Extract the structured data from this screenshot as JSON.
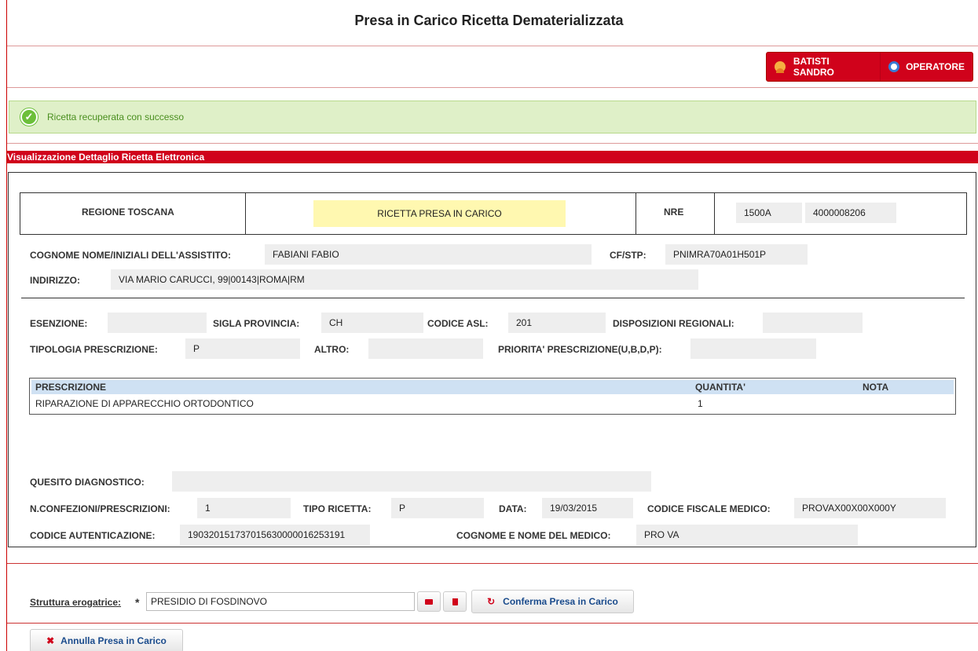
{
  "page": {
    "title": "Presa in Carico Ricetta Dematerializzata"
  },
  "user_bar": {
    "user_name": "BATISTI SANDRO",
    "role": "OPERATORE"
  },
  "message": {
    "success_text": "Ricetta recuperata con successo"
  },
  "section": {
    "title": "Visualizzazione Dettaglio Ricetta Elettronica"
  },
  "header": {
    "region": "REGIONE TOSCANA",
    "status": "RICETTA PRESA IN CARICO",
    "nre_label": "NRE",
    "nre_part1": "1500A",
    "nre_part2": "4000008206"
  },
  "patient": {
    "name_label": "COGNOME NOME/INIZIALI DELL'ASSISTITO:",
    "name_value": "FABIANI FABIO",
    "cf_label": "CF/STP:",
    "cf_value": "PNIMRA70A01H501P",
    "address_label": "INDIRIZZO:",
    "address_value": "VIA MARIO CARUCCI, 99|00143|ROMA|RM"
  },
  "details": {
    "esenzione_label": "ESENZIONE:",
    "esenzione_value": "",
    "sigla_label": "SIGLA PROVINCIA:",
    "sigla_value": "CH",
    "asl_label": "CODICE ASL:",
    "asl_value": "201",
    "disposizioni_label": "DISPOSIZIONI REGIONALI:",
    "disposizioni_value": "",
    "tipologia_label": "TIPOLOGIA PRESCRIZIONE:",
    "tipologia_value": "P",
    "altro_label": "ALTRO:",
    "altro_value": "",
    "priorita_label": "PRIORITA' PRESCRIZIONE(U,B,D,P):",
    "priorita_value": ""
  },
  "prescriptions": {
    "columns": [
      "PRESCRIZIONE",
      "QUANTITA'",
      "NOTA"
    ],
    "rows": [
      {
        "prescrizione": "RIPARAZIONE DI APPARECCHIO ORTODONTICO",
        "quantita": "1",
        "nota": ""
      }
    ]
  },
  "footer_info": {
    "quesito_label": "QUESITO DIAGNOSTICO:",
    "quesito_value": "",
    "confezioni_label": "N.CONFEZIONI/PRESCRIZIONI:",
    "confezioni_value": "1",
    "tipo_label": "TIPO RICETTA:",
    "tipo_value": "P",
    "data_label": "DATA:",
    "data_value": "19/03/2015",
    "cf_medico_label": "CODICE FISCALE MEDICO:",
    "cf_medico_value": "PROVAX00X00X000Y",
    "auth_label": "CODICE AUTENTICAZIONE:",
    "auth_value": "190320151737015630000016253191",
    "medico_label": "COGNOME E NOME DEL MEDICO:",
    "medico_value": "PRO VA"
  },
  "form": {
    "struttura_label": "Struttura erogatrice:",
    "required_mark": "*",
    "struttura_value": "PRESIDIO DI FOSDINOVO",
    "confirm_label": "Conferma Presa in Carico",
    "cancel_label": "Annulla Presa in Carico"
  },
  "colors": {
    "accent_red": "#d0021b",
    "success_bg": "#dff0c8",
    "table_header": "#cfe1f3"
  }
}
